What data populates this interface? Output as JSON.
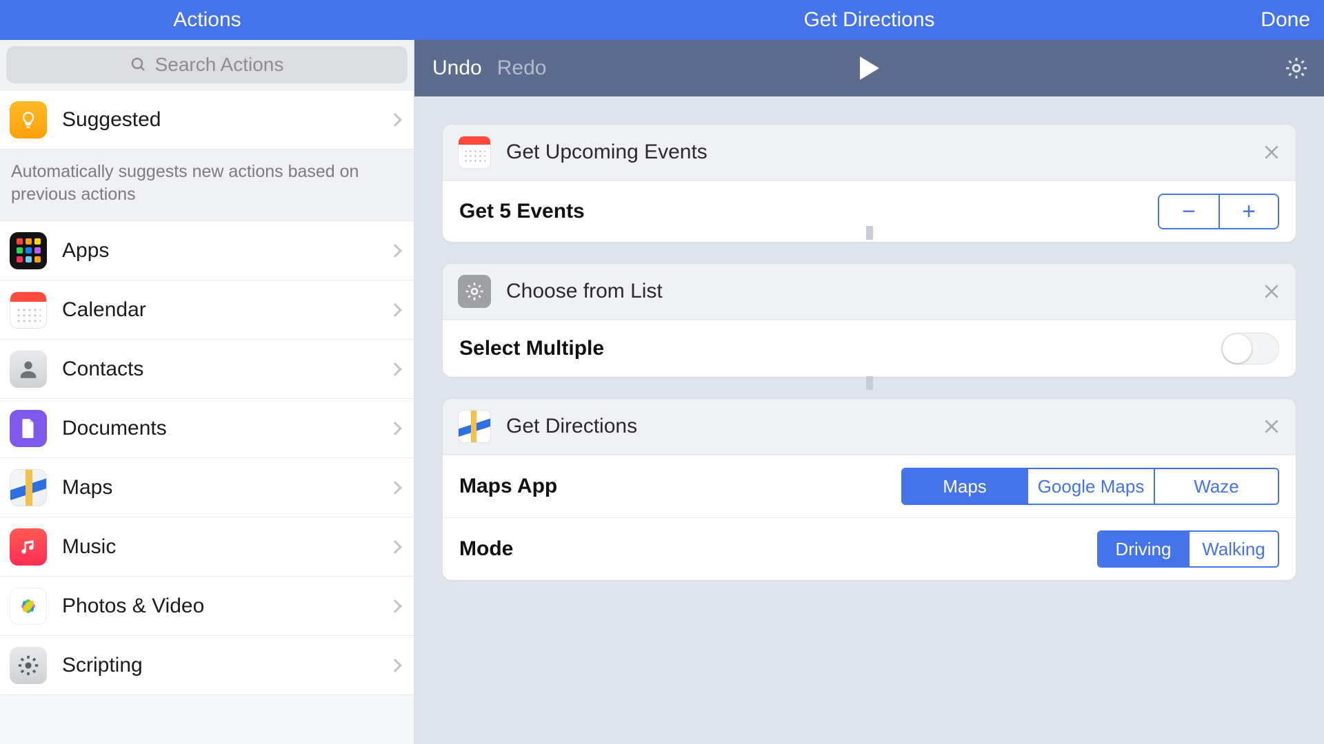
{
  "top": {
    "sidebar_title": "Actions",
    "editor_title": "Get Directions",
    "done": "Done"
  },
  "toolbar": {
    "undo": "Undo",
    "redo": "Redo"
  },
  "search": {
    "placeholder": "Search Actions"
  },
  "suggested": {
    "label": "Suggested",
    "note": "Automatically suggests new actions based on previous actions"
  },
  "categories": [
    {
      "id": "apps",
      "label": "Apps"
    },
    {
      "id": "calendar",
      "label": "Calendar"
    },
    {
      "id": "contacts",
      "label": "Contacts"
    },
    {
      "id": "documents",
      "label": "Documents"
    },
    {
      "id": "maps",
      "label": "Maps"
    },
    {
      "id": "music",
      "label": "Music"
    },
    {
      "id": "photos",
      "label": "Photos & Video"
    },
    {
      "id": "scripting",
      "label": "Scripting"
    }
  ],
  "cards": {
    "upcoming": {
      "title": "Get Upcoming Events",
      "row_label": "Get 5 Events",
      "count": 5
    },
    "choose": {
      "title": "Choose from List",
      "row_label": "Select Multiple",
      "toggle_on": false
    },
    "directions": {
      "title": "Get Directions",
      "maps_label": "Maps App",
      "maps_options": [
        "Maps",
        "Google Maps",
        "Waze"
      ],
      "maps_selected": "Maps",
      "mode_label": "Mode",
      "mode_options": [
        "Driving",
        "Walking"
      ],
      "mode_selected": "Driving"
    }
  }
}
